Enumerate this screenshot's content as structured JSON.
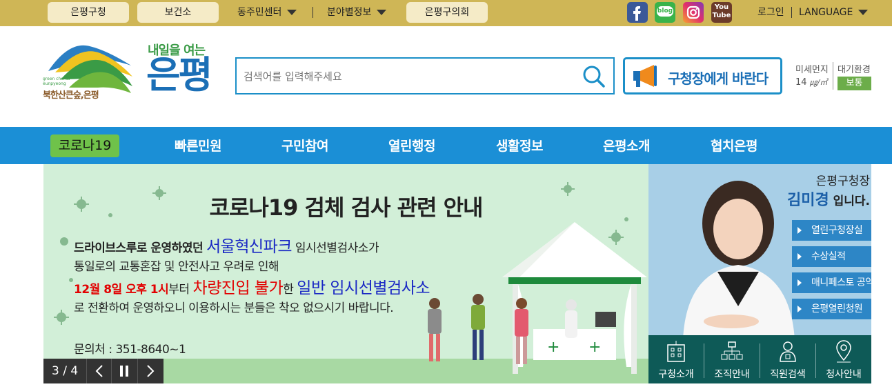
{
  "topbar": {
    "links": [
      "은평구청",
      "보건소",
      "동주민센터",
      "분야별정보",
      "은평구의회"
    ],
    "sns": [
      "facebook-icon",
      "blog-icon",
      "instagram-icon",
      "youtube-icon"
    ],
    "blog_label": "blog",
    "youtube_label": "You\nTube",
    "login": "로그인",
    "language": "LANGUAGE"
  },
  "header": {
    "logo_sub": "북한산큰숲,은평",
    "logo_en": "green chorus eunpyeong",
    "slogan_small": "내일을 여는",
    "slogan_big": "은평",
    "search_placeholder": "검색어를 입력해주세요",
    "mayor_button": "구청장에게 바란다",
    "air": {
      "label1": "미세먼지",
      "label2": "대기환경",
      "value": "14",
      "unit": "㎍/㎥",
      "status": "보통",
      "status_color": "#6cad4a"
    }
  },
  "nav": {
    "items": [
      "코로나19",
      "빠른민원",
      "구민참여",
      "열린행정",
      "생활정보",
      "은평소개",
      "협치은평"
    ]
  },
  "banner": {
    "title": "코로나19 검체 검사 관련 안내",
    "line1_a": "드라이브스루로 운영하였던",
    "line1_b": "서울혁신파크",
    "line1_c": "임시선별검사소가",
    "line2": "통일로의 교통혼잡 및 안전사고 우려로 인해",
    "line3_a": "12월 8일 오후 1시",
    "line3_b": "부터",
    "line3_c": "차량진입 불가",
    "line3_d": "한",
    "line3_e": "일반 임시선별검사소",
    "line4": "로 전환하여 운영하오니 이용하시는 분들은 착오 없으시기 바랍니다.",
    "contact": "문의처 : 351-8640~1",
    "slide_counter": "3 / 4"
  },
  "mayor_panel": {
    "line1": "은평구청장",
    "name": "김미경",
    "line2_suffix": " 입니다.",
    "links": [
      "열린구청장실",
      "수상실적",
      "매니페스토 공약",
      "은평열린청원"
    ],
    "bottom": [
      "구청소개",
      "조직안내",
      "직원검색",
      "청사안내"
    ]
  }
}
